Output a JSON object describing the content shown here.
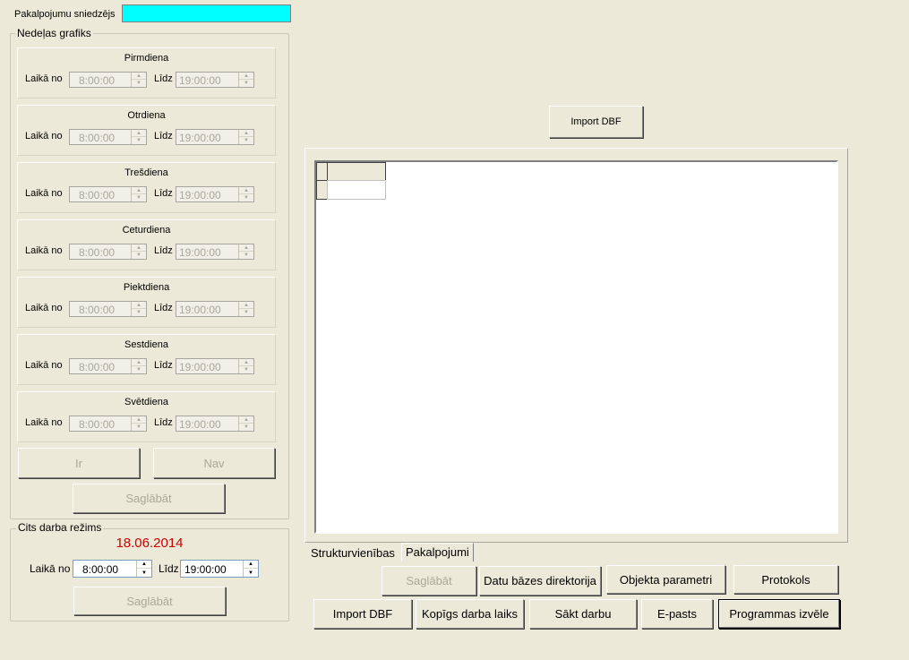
{
  "provider": {
    "label": "Pakalpojumu sniedzējs",
    "value": ""
  },
  "week": {
    "title": "Nedeļas grafiks",
    "from_label": "Laikā no",
    "to_label": "Līdz",
    "days": [
      {
        "name": "Pirmdiena",
        "from": "8:00:00",
        "to": "19:00:00"
      },
      {
        "name": "Otrdiena",
        "from": "8:00:00",
        "to": "19:00:00"
      },
      {
        "name": "Trešdiena",
        "from": "8:00:00",
        "to": "19:00:00"
      },
      {
        "name": "Ceturdiena",
        "from": "8:00:00",
        "to": "19:00:00"
      },
      {
        "name": "Piektdiena",
        "from": "8:00:00",
        "to": "19:00:00"
      },
      {
        "name": "Sestdiena",
        "from": "8:00:00",
        "to": "19:00:00"
      },
      {
        "name": "Svētdiena",
        "from": "8:00:00",
        "to": "19:00:00"
      }
    ],
    "yes_label": "Ir",
    "no_label": "Nav",
    "save_label": "Saglābāt"
  },
  "other": {
    "title": "Cits darba režims",
    "date": "18.06.2014",
    "from_label": "Laikā no",
    "from_value": "8:00:00",
    "to_label": "Līdz",
    "to_value": "19:00:00",
    "save_label": "Saglābāt"
  },
  "import_top_label": "Import DBF",
  "tabs": [
    "Strukturvienības",
    "Pakalpojumi"
  ],
  "toolbar": {
    "save_label": "Saglābāt",
    "db_dir_label": "Datu bāzes direktorija",
    "object_params_label": "Objekta parametri",
    "protocol_label": "Protokols",
    "import_label": "Import DBF",
    "common_time_label": "Kopīgs darba laiks",
    "start_label": "Sākt darbu",
    "email_label": "E-pasts",
    "program_select_label": "Programmas izvēle"
  },
  "colors": {
    "provider_field": "#00ffff",
    "date_text": "#cc0000",
    "window_bg": "#ece9d8"
  }
}
